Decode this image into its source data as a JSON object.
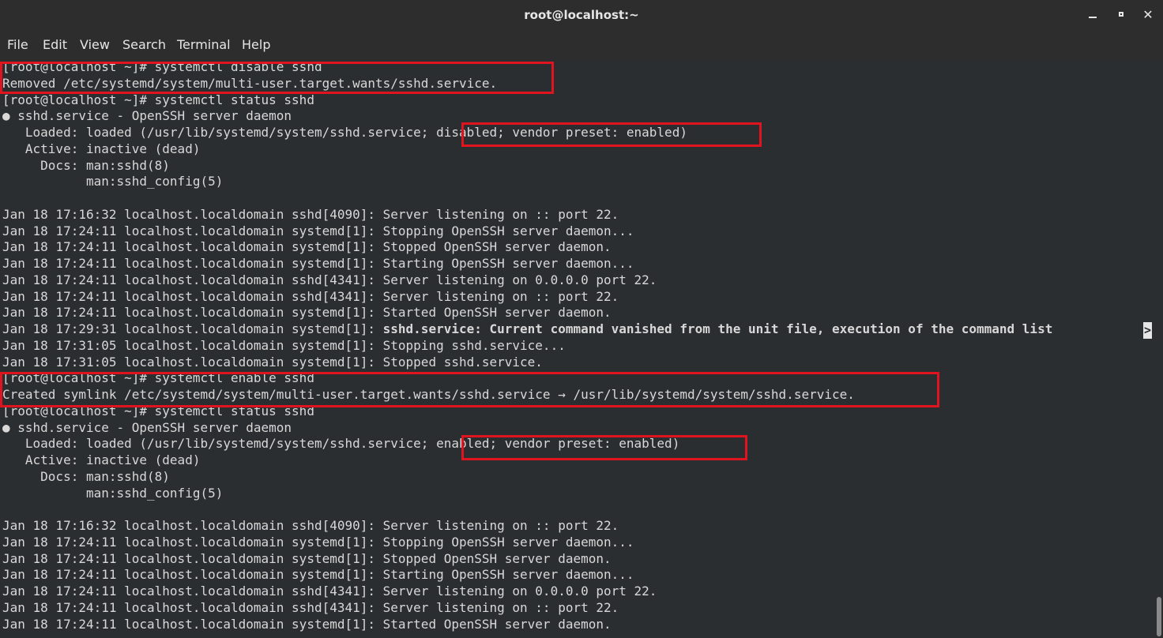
{
  "window": {
    "title": "root@localhost:~",
    "close_glyph": "✕"
  },
  "menu": [
    "File",
    "Edit",
    "View",
    "Search",
    "Terminal",
    "Help"
  ],
  "terminal": {
    "lines": [
      "[root@localhost ~]# systemctl disable sshd",
      "Removed /etc/systemd/system/multi-user.target.wants/sshd.service.",
      "[root@localhost ~]# systemctl status sshd",
      "● sshd.service - OpenSSH server daemon",
      "   Loaded: loaded (/usr/lib/systemd/system/sshd.service; disabled; vendor preset: enabled)",
      "   Active: inactive (dead)",
      "     Docs: man:sshd(8)",
      "           man:sshd_config(5)",
      "",
      "Jan 18 17:16:32 localhost.localdomain sshd[4090]: Server listening on :: port 22.",
      "Jan 18 17:24:11 localhost.localdomain systemd[1]: Stopping OpenSSH server daemon...",
      "Jan 18 17:24:11 localhost.localdomain systemd[1]: Stopped OpenSSH server daemon.",
      "Jan 18 17:24:11 localhost.localdomain systemd[1]: Starting OpenSSH server daemon...",
      "Jan 18 17:24:11 localhost.localdomain sshd[4341]: Server listening on 0.0.0.0 port 22.",
      "Jan 18 17:24:11 localhost.localdomain sshd[4341]: Server listening on :: port 22.",
      "Jan 18 17:24:11 localhost.localdomain systemd[1]: Started OpenSSH server daemon.",
      "Jan 18 17:29:31 localhost.localdomain systemd[1]: |BOLD|sshd.service: Current command vanished from the unit file, execution of the command list",
      "Jan 18 17:31:05 localhost.localdomain systemd[1]: Stopping sshd.service...",
      "Jan 18 17:31:05 localhost.localdomain systemd[1]: Stopped sshd.service.",
      "[root@localhost ~]# systemctl enable sshd",
      "Created symlink /etc/systemd/system/multi-user.target.wants/sshd.service → /usr/lib/systemd/system/sshd.service.",
      "[root@localhost ~]# systemctl status sshd",
      "● sshd.service - OpenSSH server daemon",
      "   Loaded: loaded (/usr/lib/systemd/system/sshd.service; enabled; vendor preset: enabled)",
      "   Active: inactive (dead)",
      "     Docs: man:sshd(8)",
      "           man:sshd_config(5)",
      "",
      "Jan 18 17:16:32 localhost.localdomain sshd[4090]: Server listening on :: port 22.",
      "Jan 18 17:24:11 localhost.localdomain systemd[1]: Stopping OpenSSH server daemon...",
      "Jan 18 17:24:11 localhost.localdomain systemd[1]: Stopped OpenSSH server daemon.",
      "Jan 18 17:24:11 localhost.localdomain systemd[1]: Starting OpenSSH server daemon...",
      "Jan 18 17:24:11 localhost.localdomain sshd[4341]: Server listening on 0.0.0.0 port 22.",
      "Jan 18 17:24:11 localhost.localdomain sshd[4341]: Server listening on :: port 22.",
      "Jan 18 17:24:11 localhost.localdomain systemd[1]: Started OpenSSH server daemon."
    ],
    "overflow_glyph": ">"
  },
  "colors": {
    "highlight": "#e0141e",
    "terminal_bg": "#2b2e30",
    "text": "#d8d8d8"
  }
}
